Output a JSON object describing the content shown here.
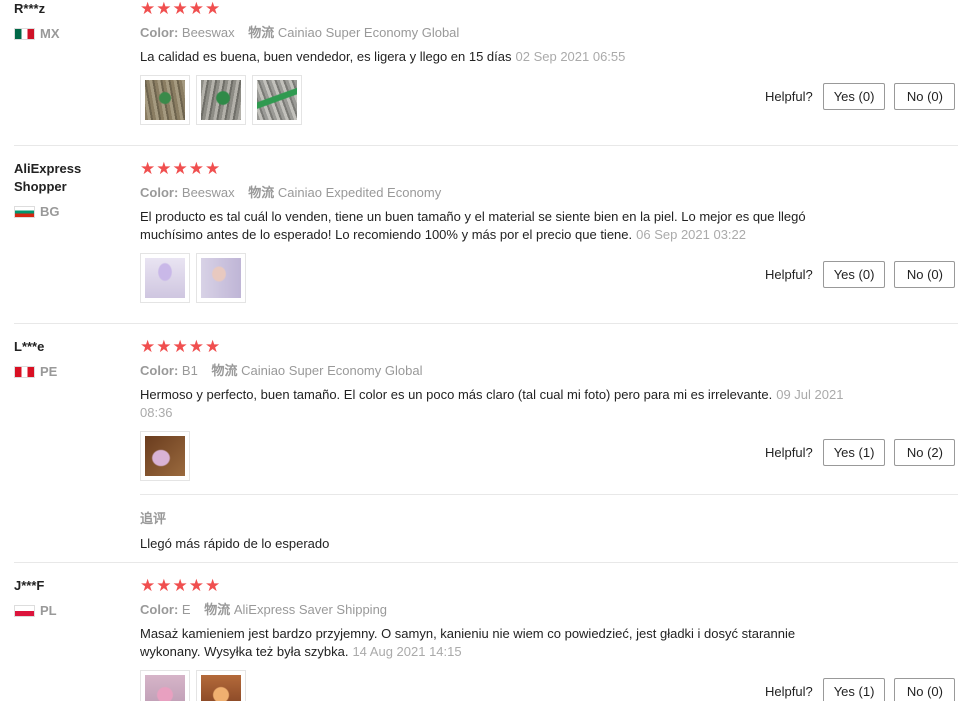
{
  "reviews": [
    {
      "user": "R***z",
      "country": "MX",
      "stars": "★★★★★",
      "color_label": "Color:",
      "color_value": "Beeswax",
      "ship_label": "物流",
      "ship_value": "Cainiao Super Economy Global",
      "text": "La calidad es buena, buen vendedor, es ligera y llego en 15 días",
      "date": "02 Sep 2021 06:55",
      "helpful_label": "Helpful?",
      "yes": "Yes (0)",
      "no": "No (0)"
    },
    {
      "user": "AliExpress Shopper",
      "country": "BG",
      "stars": "★★★★★",
      "color_label": "Color:",
      "color_value": "Beeswax",
      "ship_label": "物流",
      "ship_value": "Cainiao Expedited Economy",
      "text": "El producto es tal cuál lo venden, tiene un buen tamaño y el material se siente bien en la piel. Lo mejor es que llegó muchísimo antes de lo esperado! Lo recomiendo 100% y más por el precio que tiene.",
      "date": "06 Sep 2021 03:22",
      "helpful_label": "Helpful?",
      "yes": "Yes (0)",
      "no": "No (0)"
    },
    {
      "user": "L***e",
      "country": "PE",
      "stars": "★★★★★",
      "color_label": "Color:",
      "color_value": "B1",
      "ship_label": "物流",
      "ship_value": "Cainiao Super Economy Global",
      "text": "Hermoso y perfecto, buen tamaño. El color es un poco más claro (tal cual mi foto) pero para mi es irrelevante.",
      "date": "09 Jul 2021 08:36",
      "helpful_label": "Helpful?",
      "yes": "Yes (1)",
      "no": "No (2)",
      "followup_label": "追评",
      "followup_text": "Llegó más rápido de lo esperado"
    },
    {
      "user": "J***F",
      "country": "PL",
      "stars": "★★★★★",
      "color_label": "Color:",
      "color_value": "E",
      "ship_label": "物流",
      "ship_value": "AliExpress Saver Shipping",
      "text": "Masaż kamieniem jest bardzo przyjemny. O samyn, kanieniu nie wiem co powiedzieć, jest gładki i dosyć starannie wykonany. Wysyłka też była szybka.",
      "date": "14 Aug 2021 14:15",
      "helpful_label": "Helpful?",
      "yes": "Yes (1)",
      "no": "No (0)"
    }
  ],
  "colors": {
    "star": "#f04f4f",
    "muted": "#999999"
  }
}
